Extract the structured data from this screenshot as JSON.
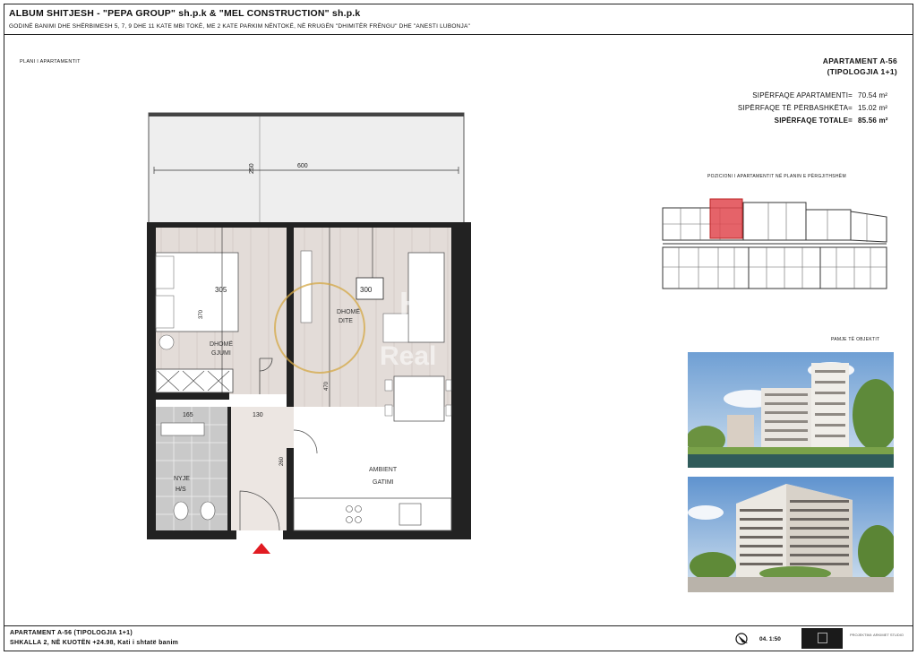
{
  "header": {
    "title": "ALBUM SHITJESH - \"PEPA GROUP\" sh.p.k & \"MEL CONSTRUCTION\" sh.p.k",
    "subtitle": "GODINË BANIMI DHE SHËRBIMESH 5, 7, 9 DHE 11 KATE MBI TOKË, ME 2 KATE PARKIM NËNTOKË, NË RRUGËN \"DHIMITËR FRËNGU\" DHE \"ANESTI LUBONJA\""
  },
  "section_label": "PLANI I APARTAMENTIT",
  "apartment": {
    "title_line1": "APARTAMENT A-56",
    "title_line2": "(TIPOLOGJIA 1+1)"
  },
  "areas": [
    {
      "label": "SIPËRFAQE APARTAMENTI=",
      "value": "70.54 m²",
      "bold": false
    },
    {
      "label": "SIPËRFAQE TË PËRBASHKËTA=",
      "value": "15.02 m²",
      "bold": false
    },
    {
      "label": "SIPËRFAQE TOTALE=",
      "value": "85.56 m²",
      "bold": true
    }
  ],
  "position_caption": "POZICIONI I APARTAMENTIT NË PLANIN E PËRGJITHSHËM",
  "views_caption": "PAMJE TË OBJEKTIT",
  "plan": {
    "dims": {
      "balcony_w": "600",
      "balcony_h": "250",
      "bed_w": "305",
      "bed_h": "370",
      "living_w": "300",
      "living_h": "470",
      "bath_w": "165",
      "hall_w": "130",
      "hall_h": "260"
    },
    "rooms": {
      "bedroom_l1": "DHOMË",
      "bedroom_l2": "GJUMI",
      "living_l1": "DHOMË",
      "living_l2": "DITE",
      "kitchen_l1": "AMBIENT",
      "kitchen_l2": "GATIMI",
      "bath_l1": "NYJE",
      "bath_l2": "H/S"
    }
  },
  "watermark": {
    "line1": "Ho",
    "line2": "Real"
  },
  "footer": {
    "line1": "APARTAMENT A-56 (TIPOLOGJIA 1+1)",
    "line2": "SHKALLA 2, NË KUOTËN +24.98, Kati i shtatë banim",
    "sheet_scale": "04. 1:50",
    "logo_text": "PROJEKTIMI: ARKIMET STUDIO"
  },
  "colors": {
    "highlight": "#e0484f",
    "wall": "#222222",
    "floor": "#e3dcd8",
    "marker": "#e11b22",
    "watermark_gold": "#d4a846"
  }
}
